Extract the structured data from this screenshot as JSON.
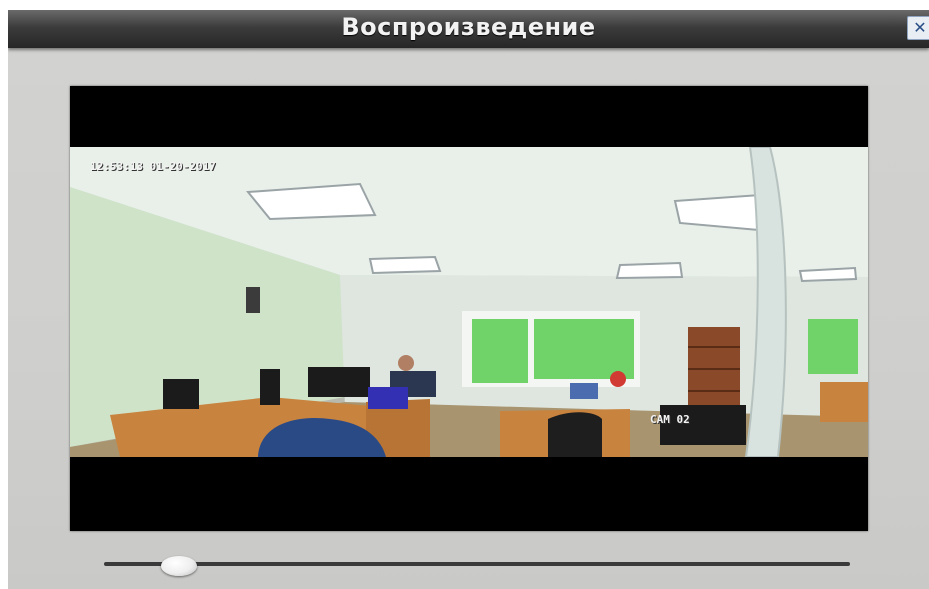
{
  "window": {
    "title": "Воспроизведение",
    "close_icon": "close-icon"
  },
  "video": {
    "timestamp": "12:53:13 01-20-2017",
    "camera_label": "CAM 02"
  },
  "playback": {
    "progress": 0.1
  },
  "colors": {
    "titlebar": "#333333",
    "panel": "#cfcfcd",
    "video_frame": "#000000",
    "close_button_icon": "#2a4f86"
  }
}
